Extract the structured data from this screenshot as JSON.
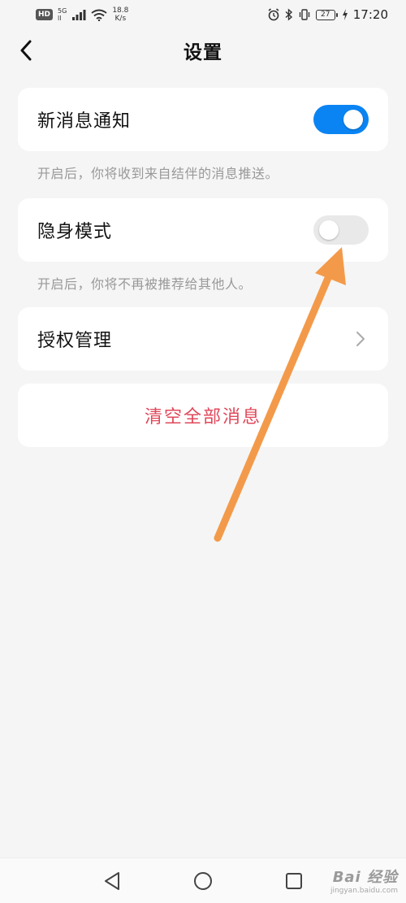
{
  "status_bar": {
    "hd": "HD",
    "network_top": "5G",
    "network_bottom": "ll",
    "speed_value": "18.8",
    "speed_unit": "K/s",
    "battery": "27",
    "time": "17:20"
  },
  "header": {
    "title": "设置",
    "back_icon": "chevron-left-icon"
  },
  "settings": {
    "notification": {
      "label": "新消息通知",
      "enabled": true,
      "hint": "开启后，你将收到来自结伴的消息推送。"
    },
    "stealth": {
      "label": "隐身模式",
      "enabled": false,
      "hint": "开启后，你将不再被推荐给其他人。"
    },
    "authorization": {
      "label": "授权管理"
    },
    "clear": {
      "label": "清空全部消息"
    }
  },
  "nav": {
    "back_icon": "triangle-back-icon",
    "home_icon": "circle-home-icon",
    "recent_icon": "square-recent-icon"
  },
  "watermark": {
    "main": "Bai 经验",
    "sub": "jingyan.baidu.com"
  },
  "colors": {
    "accent": "#0b84f3",
    "danger": "#e0485a",
    "arrow": "#f39a4a",
    "background": "#f5f5f5"
  }
}
